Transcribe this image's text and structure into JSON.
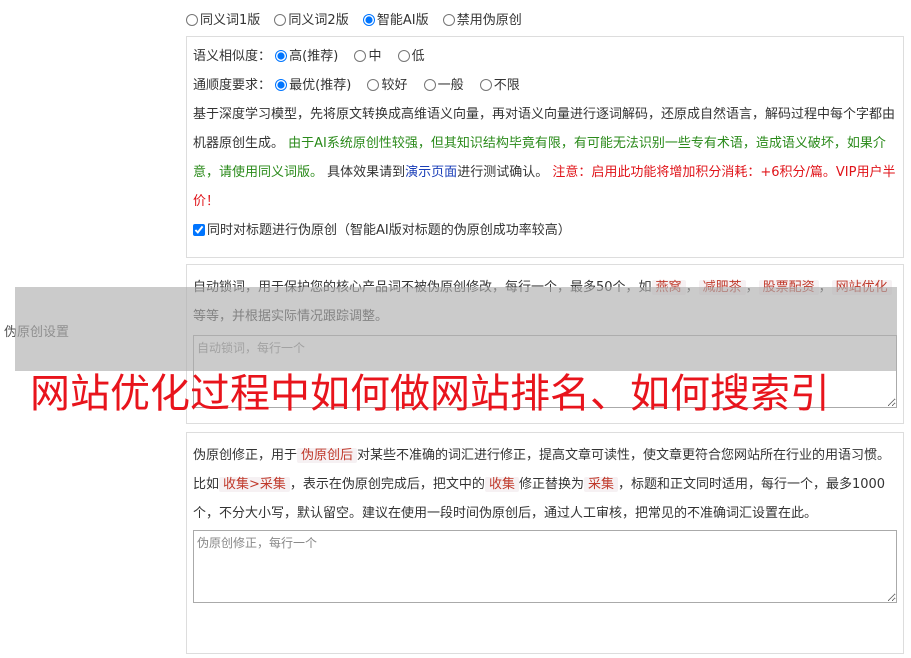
{
  "side_label": "伪原创设置",
  "version_options": [
    {
      "label": "同义词1版",
      "checked": false
    },
    {
      "label": "同义词2版",
      "checked": false
    },
    {
      "label": "智能AI版",
      "checked": true
    },
    {
      "label": "禁用伪原创",
      "checked": false
    }
  ],
  "similarity": {
    "label": "语义相似度：",
    "options": [
      {
        "label": "高(推荐)",
        "checked": true
      },
      {
        "label": "中",
        "checked": false
      },
      {
        "label": "低",
        "checked": false
      }
    ]
  },
  "fluency": {
    "label": "通顺度要求：",
    "options": [
      {
        "label": "最优(推荐)",
        "checked": true
      },
      {
        "label": "较好",
        "checked": false
      },
      {
        "label": "一般",
        "checked": false
      },
      {
        "label": "不限",
        "checked": false
      }
    ]
  },
  "ai_desc": {
    "part1": "基于深度学习模型，先将原文转换成高维语义向量，再对语义向量进行逐词解码，还原成自然语言，解码过程中每个字都由机器原创生成。",
    "green": "由于AI系统原创性较强，但其知识结构毕竟有限，有可能无法识别一些专有术语，造成语义破坏，如果介意，请使用同义词版。",
    "part2": "具体效果请到",
    "link": "演示页面",
    "part3": "进行测试确认。",
    "red": "注意：启用此功能将增加积分消耗：+6积分/篇。VIP用户半价！"
  },
  "title_checkbox": {
    "label": "同时对标题进行伪原创（智能AI版对标题的伪原创成功率较高）",
    "checked": true
  },
  "lock_words": {
    "desc_pre": "自动锁词，用于保护您的核心产品词不被伪原创修改，每行一个，最多50个，如",
    "examples": [
      "燕窝",
      "减肥茶",
      "股票配资",
      "网站优化"
    ],
    "sep": "，",
    "desc_post": "等等，并根据实际情况跟踪调整。",
    "placeholder": "自动锁词，每行一个"
  },
  "correction": {
    "t1": "伪原创修正，用于",
    "tag1": "伪原创后",
    "t2": "对某些不准确的词汇进行修正，提高文章可读性，使文章更符合您网站所在行业的用语习惯。比如",
    "tag2": "收集>采集",
    "t3": "，表示在伪原创完成后，把文中的",
    "tag3": "收集",
    "t4": "修正替换为",
    "tag4": "采集",
    "t5": "，标题和正文同时适用，每行一个，最多1000个，不分大小写，默认留空。建议在使用一段时间伪原创后，通过人工审核，把常见的不准确词汇设置在此。",
    "placeholder": "伪原创修正，每行一个"
  },
  "headline": "网站优化过程中如何做网站排名、如何搜索引"
}
